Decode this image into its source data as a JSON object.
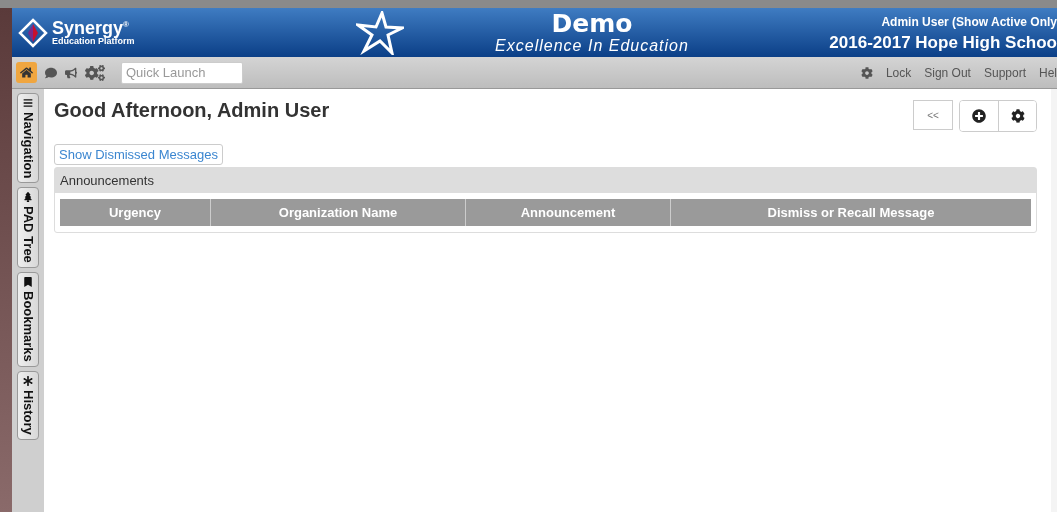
{
  "header": {
    "brand": "Synergy",
    "brand_mark": "®",
    "brand_subtitle": "Education Platform",
    "site_title": "Demo",
    "site_motto": "Excellence In Education",
    "user": "Admin User (Show Active Only",
    "school": "2016-2017 Hope High Schoo"
  },
  "toolbar": {
    "quick_launch": {
      "placeholder": "Quick Launch"
    },
    "links": [
      "Lock",
      "Sign Out",
      "Support",
      "Hel"
    ]
  },
  "side_tabs": [
    {
      "kind": "menu",
      "label": "Navigation"
    },
    {
      "kind": "tree",
      "label": "PAD Tree"
    },
    {
      "kind": "bookmark",
      "label": "Bookmarks"
    },
    {
      "kind": "history",
      "label": "History"
    }
  ],
  "page": {
    "greeting": "Good Afternoon, Admin User",
    "collapse_button": "<<",
    "show_dismissed": "Show Dismissed Messages",
    "panel_title": "Announcements",
    "columns": [
      "Urgency",
      "Organization Name",
      "Announcement",
      "Dismiss or Recall Message"
    ]
  }
}
